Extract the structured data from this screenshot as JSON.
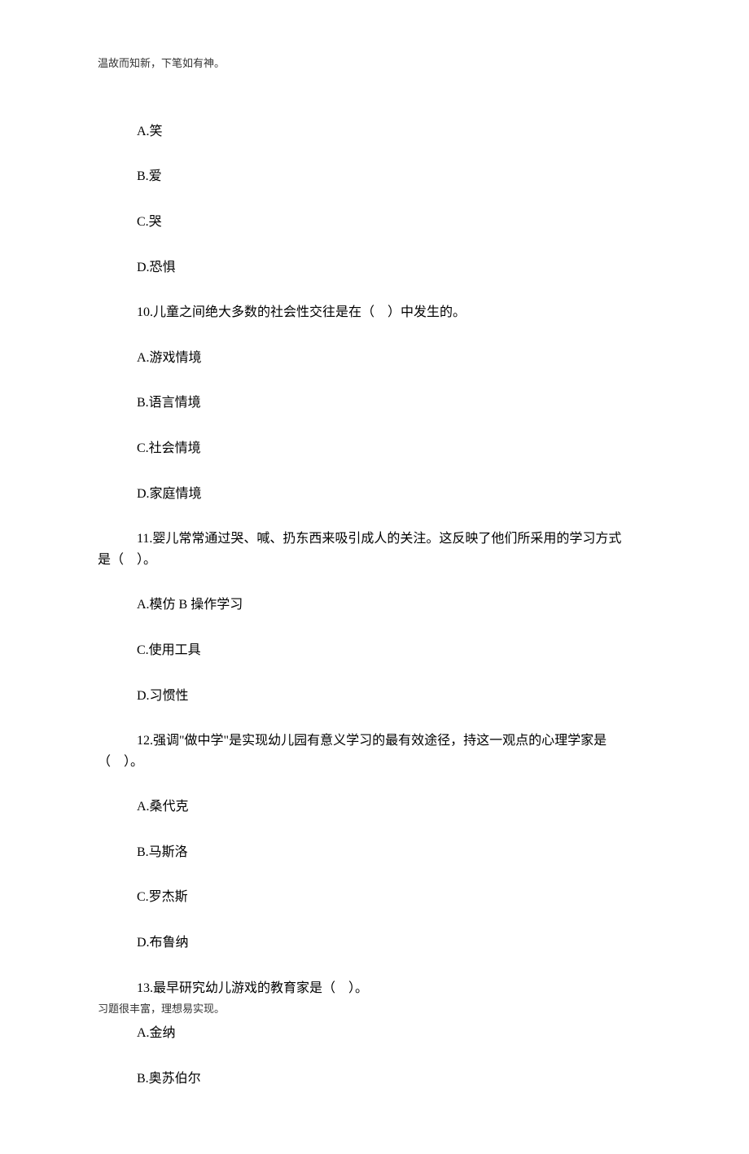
{
  "header_note": "温故而知新，下笔如有神。",
  "footer_note": "习题很丰富，理想易实现。",
  "topOptions": {
    "a": "A.笑",
    "b": "B.爱",
    "c": "C.哭",
    "d": "D.恐惧"
  },
  "q10": {
    "text": "10.儿童之间绝大多数的社会性交往是在（　）中发生的。",
    "a": "A.游戏情境",
    "b": "B.语言情境",
    "c": "C.社会情境",
    "d": "D.家庭情境"
  },
  "q11": {
    "line1": "11.婴儿常常通过哭、喊、扔东西来吸引成人的关注。这反映了他们所采用的学习方式",
    "line2": "是（　）。",
    "ab": "A.模仿 B 操作学习",
    "c": "C.使用工具",
    "d": "D.习惯性"
  },
  "q12": {
    "line1": "12.强调\"做中学\"是实现幼儿园有意义学习的最有效途径，持这一观点的心理学家是",
    "line2": "（　）。",
    "a": "A.桑代克",
    "b": "B.马斯洛",
    "c": "C.罗杰斯",
    "d": "D.布鲁纳"
  },
  "q13": {
    "text": "13.最早研究幼儿游戏的教育家是（　）。",
    "a": "A.金纳",
    "b": "B.奥苏伯尔"
  }
}
